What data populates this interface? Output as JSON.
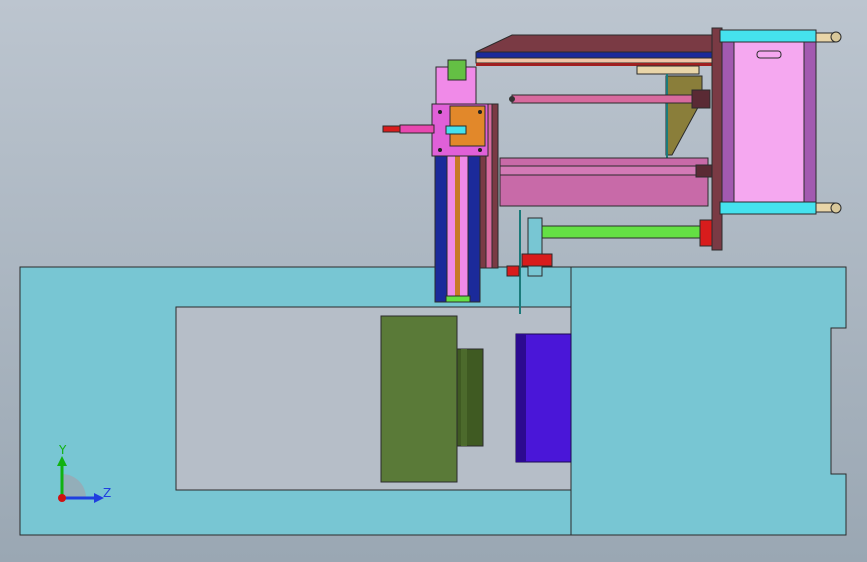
{
  "viewport": {
    "background_top": "#bcc5cf",
    "background_bottom": "#9aa7b3"
  },
  "triad": {
    "y_label": "Y",
    "z_label": "Z",
    "y_color": "#11b211",
    "z_color": "#1f3fe0",
    "origin_color": "#d01010"
  },
  "colors": {
    "base_body": "#78c6d3",
    "outline": "#2b2b2b",
    "mold_green": "#5a7a38",
    "mold_green_dark": "#3f5a22",
    "platen_blue": "#4a16d8",
    "platen_blue_dark": "#2c0a90",
    "pink": "#f08ae8",
    "violet": "#a25ab0",
    "brown": "#7a3a44",
    "orange": "#e2882a",
    "cyan": "#45e2ee",
    "magenta_rod": "#d86a9e",
    "lime_rod": "#64e044",
    "red": "#d81c1c",
    "navy": "#1b2a9a",
    "tan": "#e9d5a8"
  }
}
